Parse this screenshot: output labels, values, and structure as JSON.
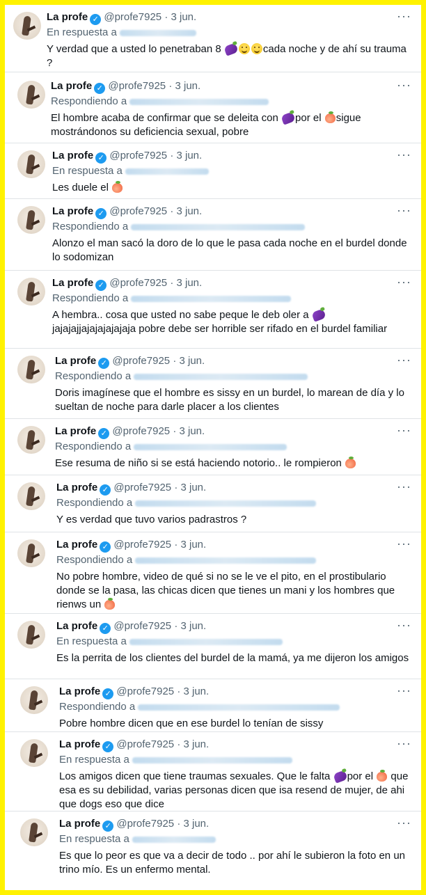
{
  "tweets": [
    {
      "name": "La profe",
      "handle": "@profe7925",
      "dot": "·",
      "date": "3 jun.",
      "reply_prefix": "En respuesta a",
      "reply_to": "@jemyers76",
      "text_parts": [
        "Y verdad que a usted lo  penetraban 8 ",
        "eggplant",
        "face",
        "face",
        "cada noche y de ahí su trauma ?"
      ]
    },
    {
      "name": "La profe",
      "handle": "@profe7925",
      "dot": "·",
      "date": "3 jun.",
      "reply_prefix": "Respondiendo a",
      "reply_to": "@donsillamann y 2 más",
      "text_parts": [
        "El hombre acaba de confirmar que se deleita con ",
        "eggplant",
        "por el ",
        "peach",
        "sigue mostrándonos su deficiencia sexual, pobre"
      ]
    },
    {
      "name": "La profe",
      "handle": "@profe7925",
      "dot": "·",
      "date": "3 jun.",
      "reply_prefix": "En respuesta a",
      "reply_to": "@...",
      "text_parts": [
        "Les duele el ",
        "peach"
      ]
    },
    {
      "name": "La profe",
      "handle": "@profe7925",
      "dot": "·",
      "date": "3 jun.",
      "reply_prefix": "Respondiendo a",
      "reply_to": "@... @jemyers76 y 2 más",
      "text_parts": [
        "Alonzo el man sacó la doro de lo que le pasa cada noche en el burdel donde lo sodomizan"
      ]
    },
    {
      "name": "La profe",
      "handle": "@profe7925",
      "dot": "·",
      "date": "3 jun.",
      "reply_prefix": "Respondiendo a",
      "reply_to": "@jemyers76 y 2 más",
      "text_parts": [
        "A hembra.. cosa que usted no sabe peque le deb oler a ",
        "eggplant",
        " jajajajjajajajajajaja pobre debe ser horrible ser rifado en el burdel familiar"
      ]
    },
    {
      "name": "La profe",
      "handle": "@profe7925",
      "dot": "·",
      "date": "3 jun.",
      "reply_prefix": "Respondiendo a",
      "reply_to": "@... @Alonzo_Ja... y 2 más",
      "text_parts": [
        "Doris imagínese que el hombre es sissy en un burdel, lo marean de día y lo sueltan de noche para darle placer a los clientes"
      ]
    },
    {
      "name": "La profe",
      "handle": "@profe7925",
      "dot": "·",
      "date": "3 jun.",
      "reply_prefix": "Respondiendo a",
      "reply_to": "@... @donsillamann y 2 más",
      "text_parts": [
        "Ese resuma de niño si se está haciendo notorio.. le rompieron ",
        "peach"
      ]
    },
    {
      "name": "La profe",
      "handle": "@profe7925",
      "dot": "·",
      "date": "3 jun.",
      "reply_prefix": "Respondiendo a",
      "reply_to": "@jemyers76 @Alonzo_Jarris_2 y 2 más",
      "text_parts": [
        "Y es verdad que tuvo varios padrastros ?"
      ]
    },
    {
      "name": "La profe",
      "handle": "@profe7925",
      "dot": "·",
      "date": "3 jun.",
      "reply_prefix": "Respondiendo a",
      "reply_to": "@... @Alonzo_Jarris_2 y 2 más",
      "text_parts": [
        "No pobre hombre, video de qué si no se le ve el pito, en el prostibulario donde se la pasa, las chicas dicen que tienes un mani y los hombres que rienws un ",
        "peach"
      ]
    },
    {
      "name": "La profe",
      "handle": "@profe7925",
      "dot": "·",
      "date": "3 jun.",
      "reply_prefix": "En respuesta a",
      "reply_to": "@...tonberto y @jemyers76",
      "text_parts": [
        "Es la perrita de los clientes del burdel de la mamá, ya me dijeron los amigos"
      ]
    },
    {
      "name": "La profe",
      "handle": "@profe7925",
      "dot": "·",
      "date": "3 jun.",
      "reply_prefix": "Respondiendo a",
      "reply_to": "@Alonzo_Jarris_2 @... y 2 más",
      "text_parts": [
        "Pobre hombre dicen que en ese burdel lo tenían de sissy"
      ]
    },
    {
      "name": "La profe",
      "handle": "@profe7925",
      "dot": "·",
      "date": "3 jun.",
      "reply_prefix": "En respuesta a",
      "reply_to": "@...lotrak2405 y @jemyers76",
      "text_parts": [
        "Los amigos dicen que tiene traumas sexuales. Que le falta ",
        "eggplant",
        "por el ",
        "peach",
        " que esa es su debilidad, varias personas dicen que isa resend de mujer, de ahi que dogs eso que dice"
      ]
    },
    {
      "name": "La profe",
      "handle": "@profe7925",
      "dot": "·",
      "date": "3 jun.",
      "reply_prefix": "En respuesta a",
      "reply_to": "@...",
      "text_parts": [
        "Es que lo peor es que va a decir de todo .. por ahí le subieron la foto en un trino mío. Es un enfermo mental."
      ]
    }
  ],
  "icons": {
    "verified": "verified-badge-icon",
    "more": "more-options-icon",
    "peach": "peach-emoji-icon",
    "eggplant": "eggplant-emoji-icon",
    "face": "smiling-face-emoji-icon"
  },
  "colors": {
    "frame": "#fff200",
    "verified": "#1d9bf0",
    "secondary_text": "#536471",
    "mention": "#1d9bf0"
  }
}
